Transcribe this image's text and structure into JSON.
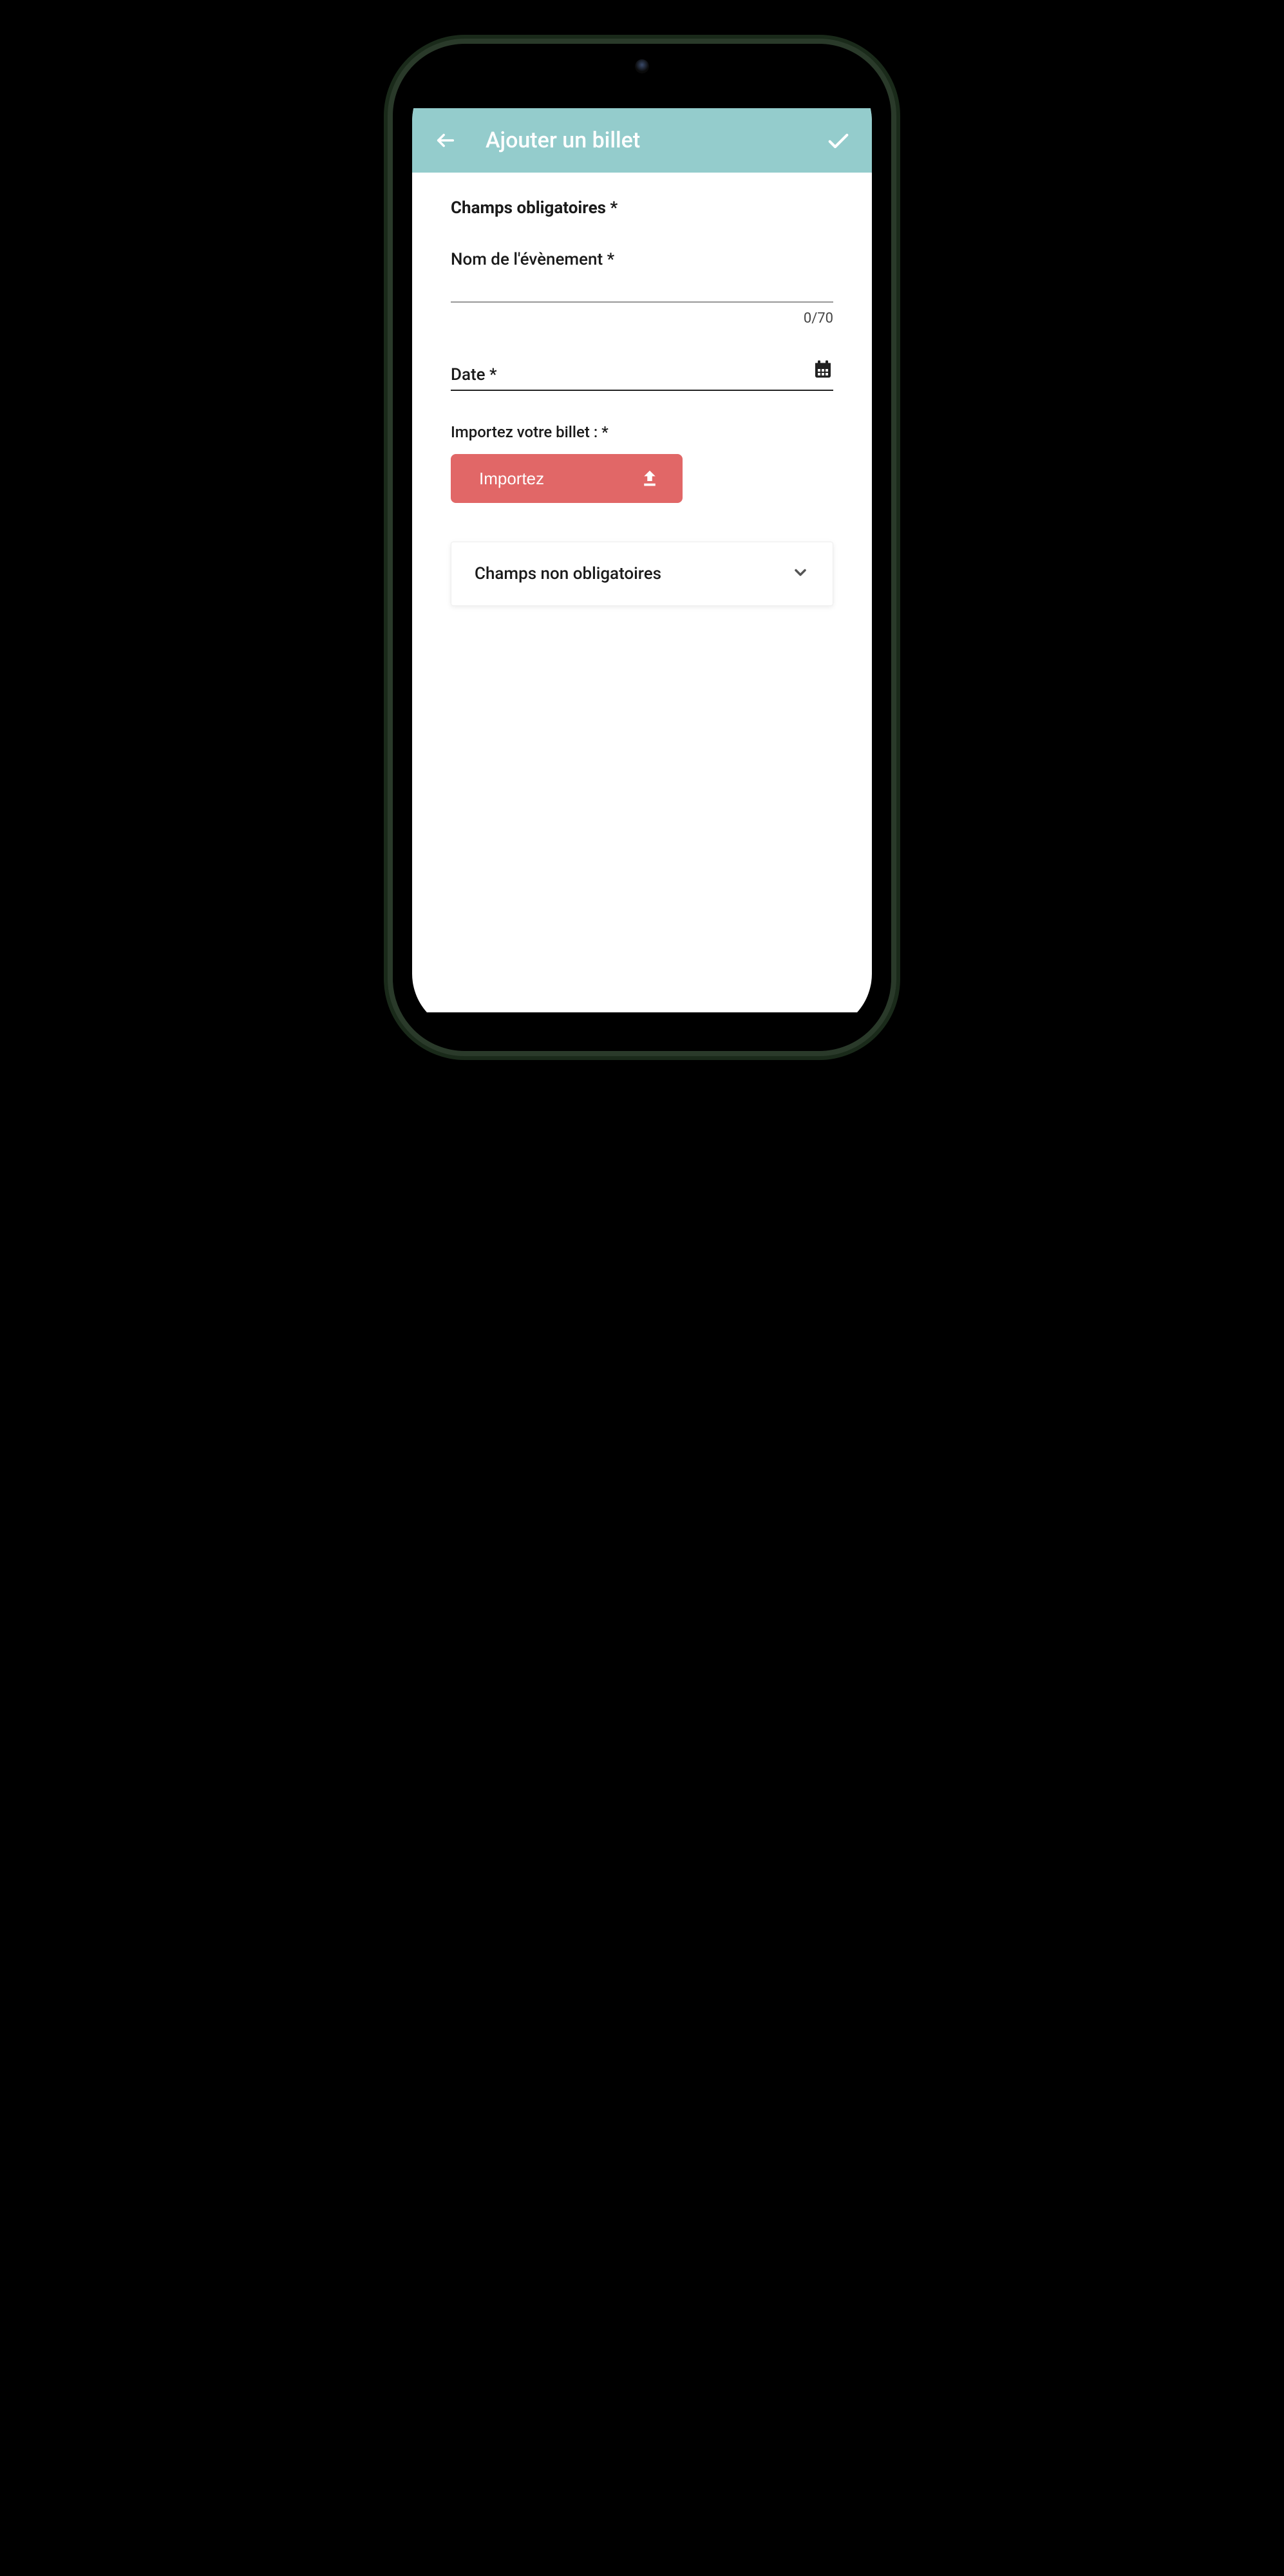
{
  "header": {
    "title": "Ajouter un billet"
  },
  "form": {
    "section_title": "Champs obligatoires *",
    "event_name": {
      "label": "Nom de l'évènement *",
      "value": "",
      "counter": "0/70"
    },
    "date": {
      "label": "Date *",
      "value": ""
    },
    "import": {
      "label": "Importez votre billet : *",
      "button_label": "Importez"
    },
    "optional_section": {
      "label": "Champs non obligatoires"
    }
  }
}
